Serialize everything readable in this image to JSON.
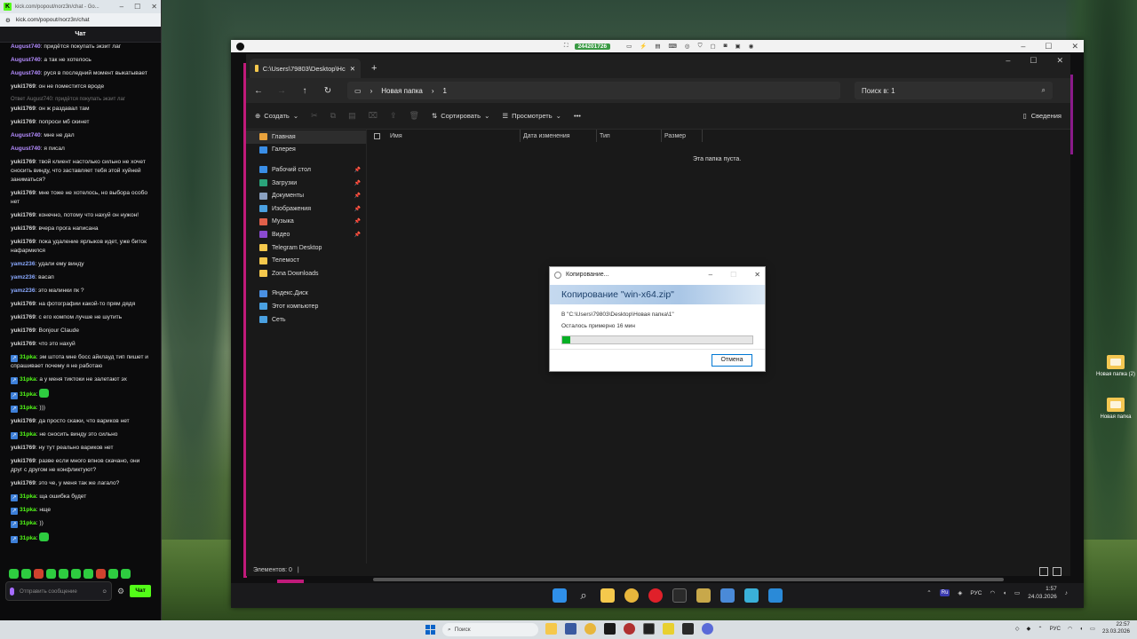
{
  "chat": {
    "tab_title": "kick.com/popout/norz3n/chat - Go...",
    "url": "kick.com/popout/norz3n/chat",
    "header": "Чат",
    "messages": [
      {
        "user": "August740",
        "text": "придётся покупать экзит лаг",
        "cls": "u-aug"
      },
      {
        "user": "August740",
        "text": "а так не хотелось",
        "cls": "u-aug"
      },
      {
        "user": "August740",
        "text": "руся в последний момент выкатывает",
        "cls": "u-aug"
      },
      {
        "user": "yuki1769",
        "text": "он не поместится вроде",
        "cls": "u-yuki"
      },
      {
        "reply": "Ответ August740: придётся покупать экзит лаг"
      },
      {
        "user": "yuki1769",
        "text": "он ж раздавал там",
        "cls": "u-yuki"
      },
      {
        "user": "yuki1769",
        "text": "попроси мб скинет",
        "cls": "u-yuki"
      },
      {
        "user": "August740",
        "text": "мне не дал",
        "cls": "u-aug"
      },
      {
        "user": "August740",
        "text": "я писал",
        "cls": "u-aug"
      },
      {
        "user": "yuki1769",
        "text": "твой клиент настолько сильно не хочет сносить винду, что заставляет тебя этой хуйней заниматься?",
        "cls": "u-yuki"
      },
      {
        "user": "yuki1769",
        "text": "мне тоже не хотелось, но выбора особо нет",
        "cls": "u-yuki"
      },
      {
        "user": "yuki1769",
        "text": "конечно, потому что нахуй он нужон!",
        "cls": "u-yuki"
      },
      {
        "user": "yuki1769",
        "text": "вчера прога написана",
        "cls": "u-yuki"
      },
      {
        "user": "yuki1769",
        "text": "пока удаление ярлыков идет, уже биток нафармился",
        "cls": "u-yuki"
      },
      {
        "user": "yamz236",
        "text": "удали ему винду",
        "cls": "u-yamz"
      },
      {
        "user": "yamz236",
        "text": "васап",
        "cls": "u-yamz"
      },
      {
        "user": "yamz236",
        "text": "это малинки пк ?",
        "cls": "u-yamz"
      },
      {
        "user": "yuki1769",
        "text": "на фотографии какой-то прям дядя",
        "cls": "u-yuki"
      },
      {
        "user": "yuki1769",
        "text": "с его компом лучше не шутить",
        "cls": "u-yuki"
      },
      {
        "user": "yuki1769",
        "text": "Bonjour Claude",
        "cls": "u-yuki"
      },
      {
        "user": "yuki1769",
        "text": "что это нахуй",
        "cls": "u-yuki"
      },
      {
        "user": "31pka",
        "text": "эм штота мне босс айклауд тип пишет и спрашивает почему я не работаю",
        "cls": "u-31",
        "badge": true
      },
      {
        "user": "31pka",
        "text": "а у меня тиктоки не залетают эх",
        "cls": "u-31",
        "badge": true
      },
      {
        "user": "31pka",
        "text": "",
        "cls": "u-31",
        "badge": true,
        "emote": true
      },
      {
        "user": "31pka",
        "text": ")))",
        "cls": "u-31",
        "badge": true
      },
      {
        "user": "yuki1769",
        "text": "да просто скажи, что вариков нет",
        "cls": "u-yuki"
      },
      {
        "user": "31pka",
        "text": "не сносить винду это сильно",
        "cls": "u-31",
        "badge": true
      },
      {
        "user": "yuki1769",
        "text": "ну тут реально вариков нет",
        "cls": "u-yuki"
      },
      {
        "user": "yuki1769",
        "text": "разве если много впнов скачано, они друг с другом не конфликтуют?",
        "cls": "u-yuki"
      },
      {
        "user": "yuki1769",
        "text": "это че, у меня так же лагало?",
        "cls": "u-yuki"
      },
      {
        "user": "31pka",
        "text": "ща ошибка будет",
        "cls": "u-31",
        "badge": true
      },
      {
        "user": "31pka",
        "text": "нще",
        "cls": "u-31",
        "badge": true
      },
      {
        "user": "31pka",
        "text": "))",
        "cls": "u-31",
        "badge": true
      },
      {
        "user": "31pka",
        "text": "",
        "cls": "u-31",
        "badge": true,
        "emote": true
      }
    ],
    "input_placeholder": "Отправить сообщение",
    "send_label": "Чат"
  },
  "app": {
    "session_id": "244201726"
  },
  "explorer": {
    "tab_title": "C:\\Users\\79803\\Desktop\\Нс",
    "breadcrumb": [
      "Новая папка",
      "1"
    ],
    "search_placeholder": "Поиск в: 1",
    "toolbar": {
      "create": "Создать",
      "sort": "Сортировать",
      "view": "Просмотреть",
      "details": "Сведения"
    },
    "sidebar": [
      {
        "label": "Главная",
        "color": "#e8a23c"
      },
      {
        "label": "Галерея",
        "color": "#3a8ee6"
      },
      {
        "gap": true
      },
      {
        "label": "Рабочий стол",
        "color": "#3a8ee6",
        "pinned": true
      },
      {
        "label": "Загрузки",
        "color": "#2aa37a",
        "pinned": true
      },
      {
        "label": "Документы",
        "color": "#8aa0c0",
        "pinned": true
      },
      {
        "label": "Изображения",
        "color": "#4aa0e0",
        "pinned": true
      },
      {
        "label": "Музыка",
        "color": "#e0604a",
        "pinned": true
      },
      {
        "label": "Видео",
        "color": "#8a4ad0",
        "pinned": true
      },
      {
        "label": "Telegram Desktop",
        "color": "#f5c84c"
      },
      {
        "label": "Телемост",
        "color": "#f5c84c"
      },
      {
        "label": "Zona Downloads",
        "color": "#f5c84c"
      },
      {
        "gap": true
      },
      {
        "label": "Яндекс.Диск",
        "color": "#4a90e2"
      },
      {
        "label": "Этот компьютер",
        "color": "#4aa0e0"
      },
      {
        "label": "Сеть",
        "color": "#4aa0e0"
      }
    ],
    "columns": [
      "Имя",
      "Дата изменения",
      "Тип",
      "Размер"
    ],
    "empty_text": "Эта папка пуста.",
    "status": "Элементов: 0"
  },
  "dialog": {
    "title": "Копирование...",
    "heading": "Копирование \"win-x64.zip\"",
    "destination": "В \"C:\\Users\\79803\\Desktop\\Новая папка\\1\"",
    "remaining": "Осталось примерно 16 мин",
    "progress": 0.04,
    "cancel_label": "Отмена"
  },
  "inner_taskbar": {
    "lang": "РУС",
    "time": "1:57",
    "date": "24.03.2026",
    "ru_badge": "Ru"
  },
  "desktop_icons": [
    {
      "label": "Новая папка (2)"
    },
    {
      "label": "Новая папка"
    }
  ],
  "taskbar": {
    "search_placeholder": "Поиск",
    "lang": "РУС",
    "time": "22:57",
    "date": "23.03.2026"
  }
}
